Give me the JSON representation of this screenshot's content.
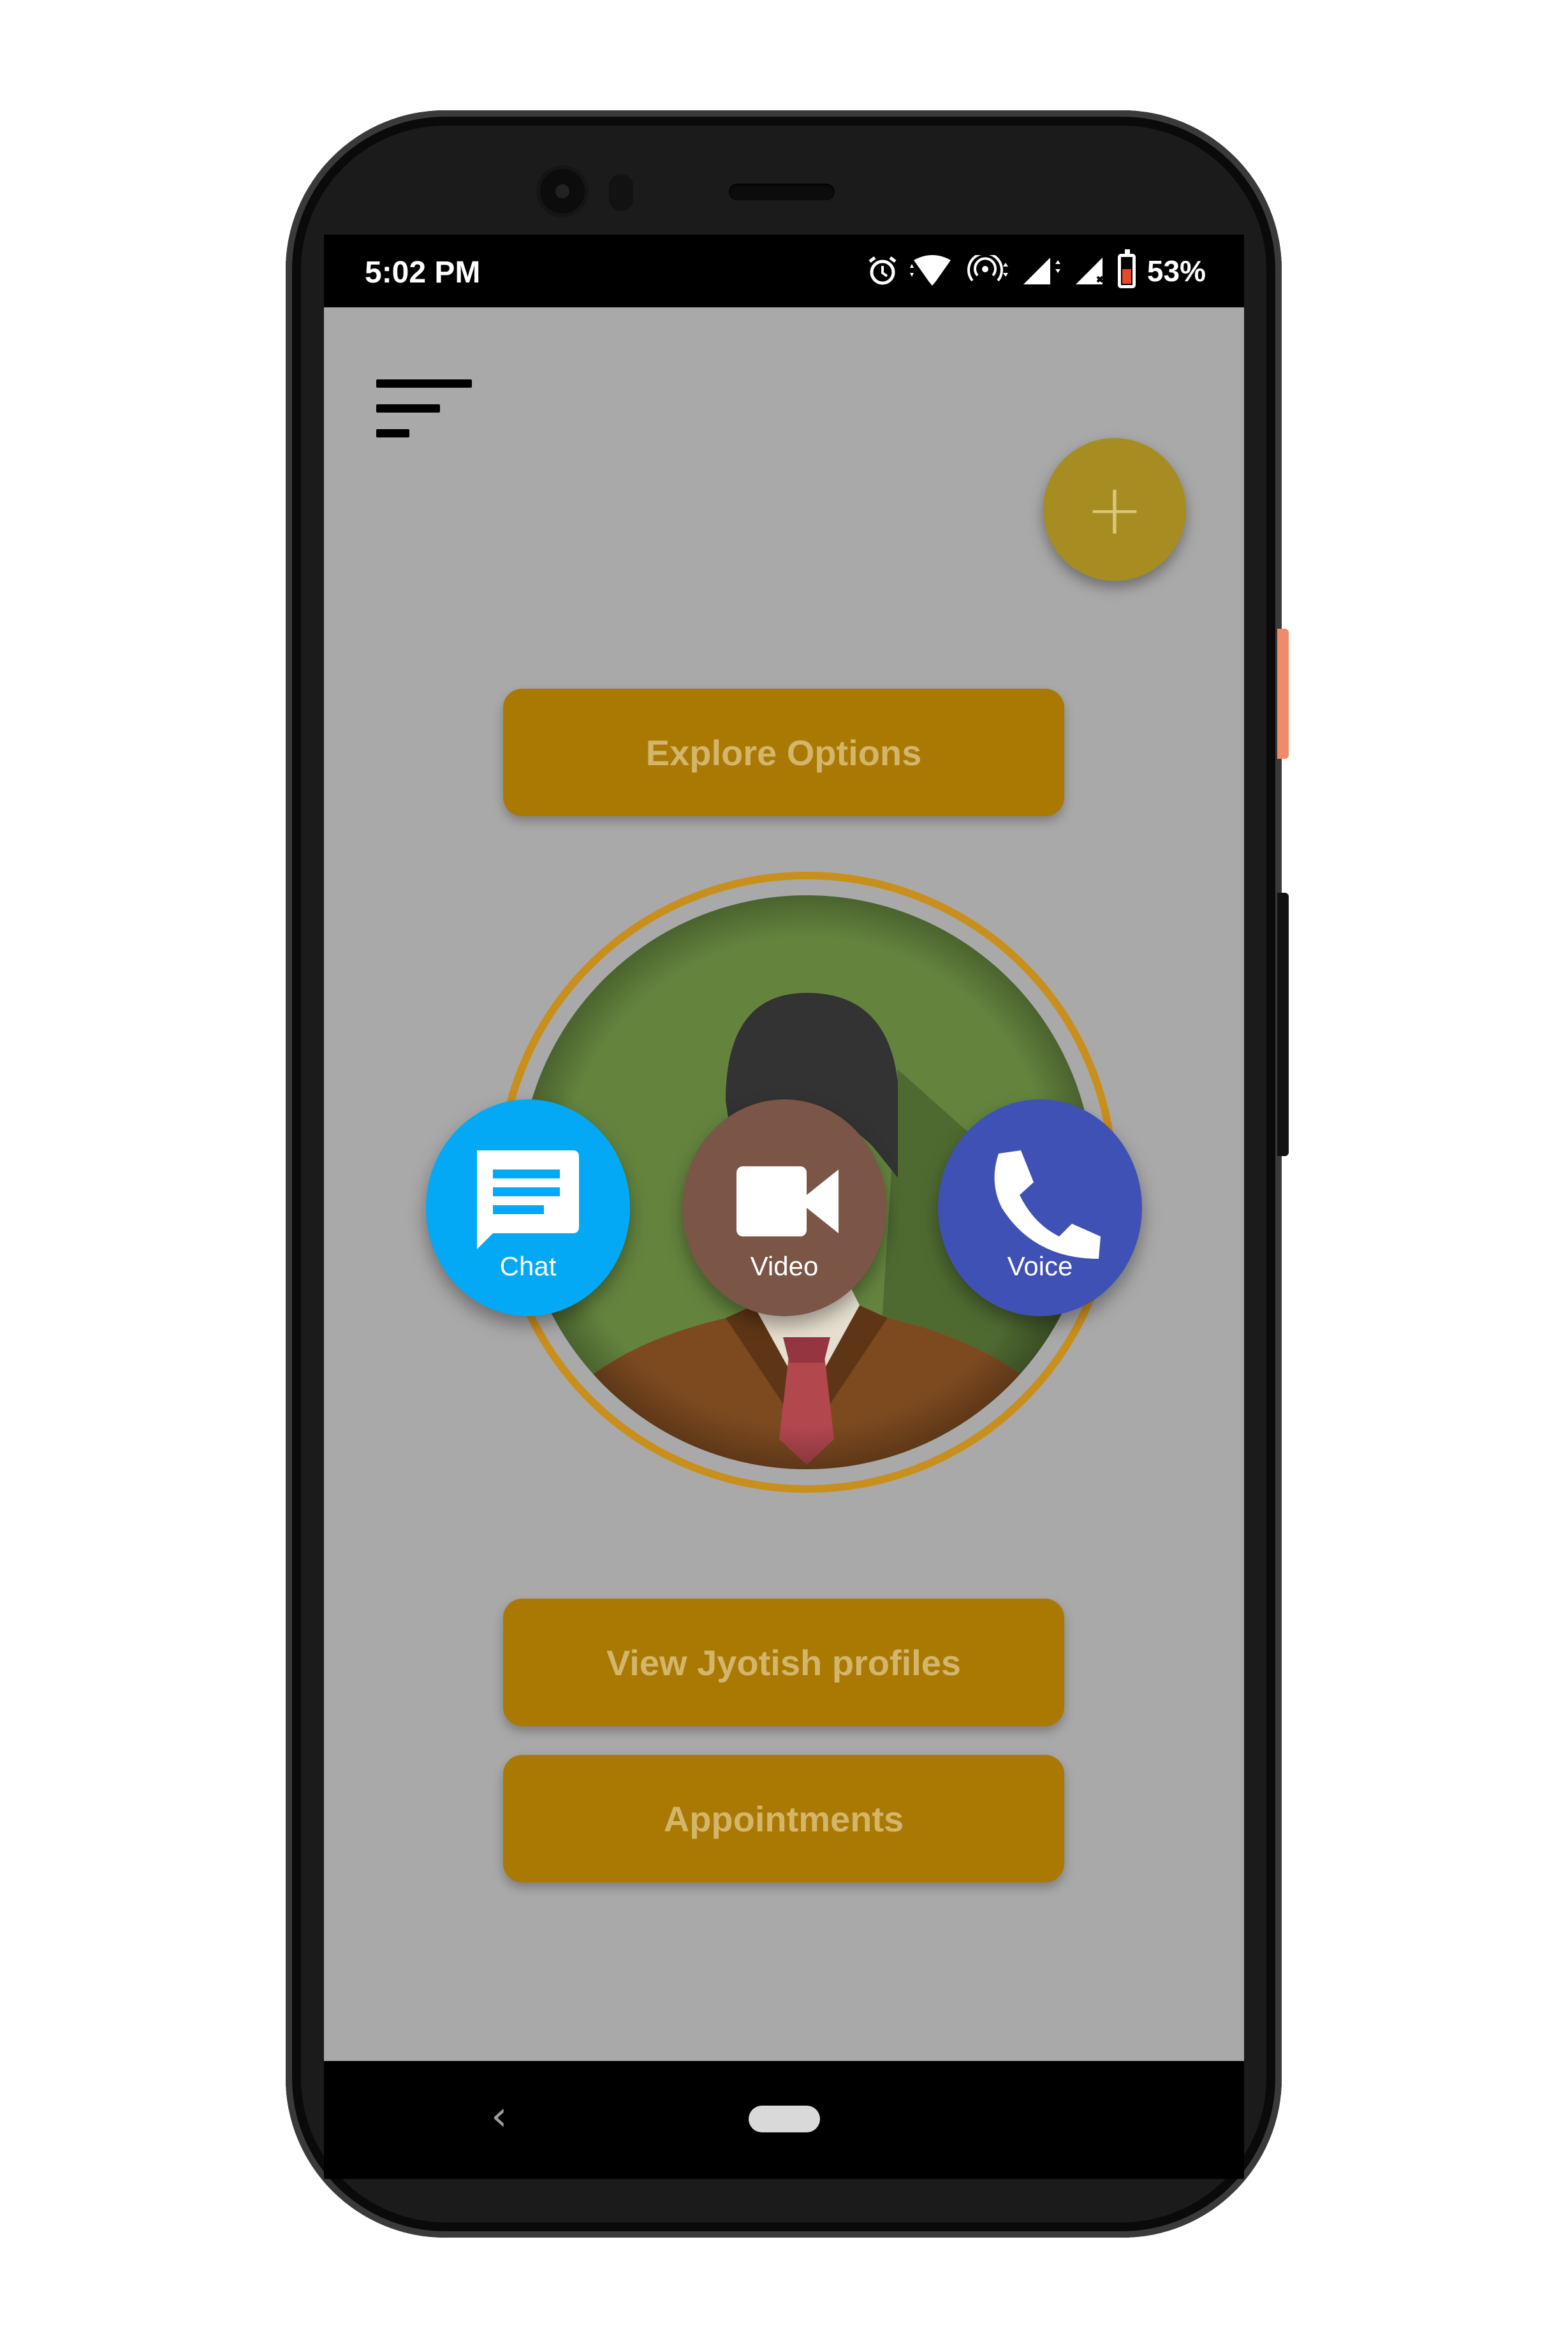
{
  "status_bar": {
    "time": "5:02 PM",
    "battery_percent": "53%",
    "icons": [
      "alarm-icon",
      "wifi-icon",
      "hotspot-icon",
      "signal-1-icon",
      "signal-2-icon",
      "battery-icon"
    ]
  },
  "toolbar": {
    "menu_icon": "sort-menu-icon",
    "fab_label": "+"
  },
  "main": {
    "explore_button": "Explore Options",
    "view_profiles_button": "View Jyotish profiles",
    "appointments_button": "Appointments"
  },
  "call_options": {
    "chat_label": "Chat",
    "video_label": "Video",
    "voice_label": "Voice"
  },
  "nav_bar": {
    "back_label": "‹"
  },
  "colors": {
    "screen_bg": "#a9a9a9",
    "button_gold": "#aa7902",
    "chat_blue": "#03a9f4",
    "video_brown": "#7b5546",
    "voice_indigo": "#3f51b5"
  }
}
